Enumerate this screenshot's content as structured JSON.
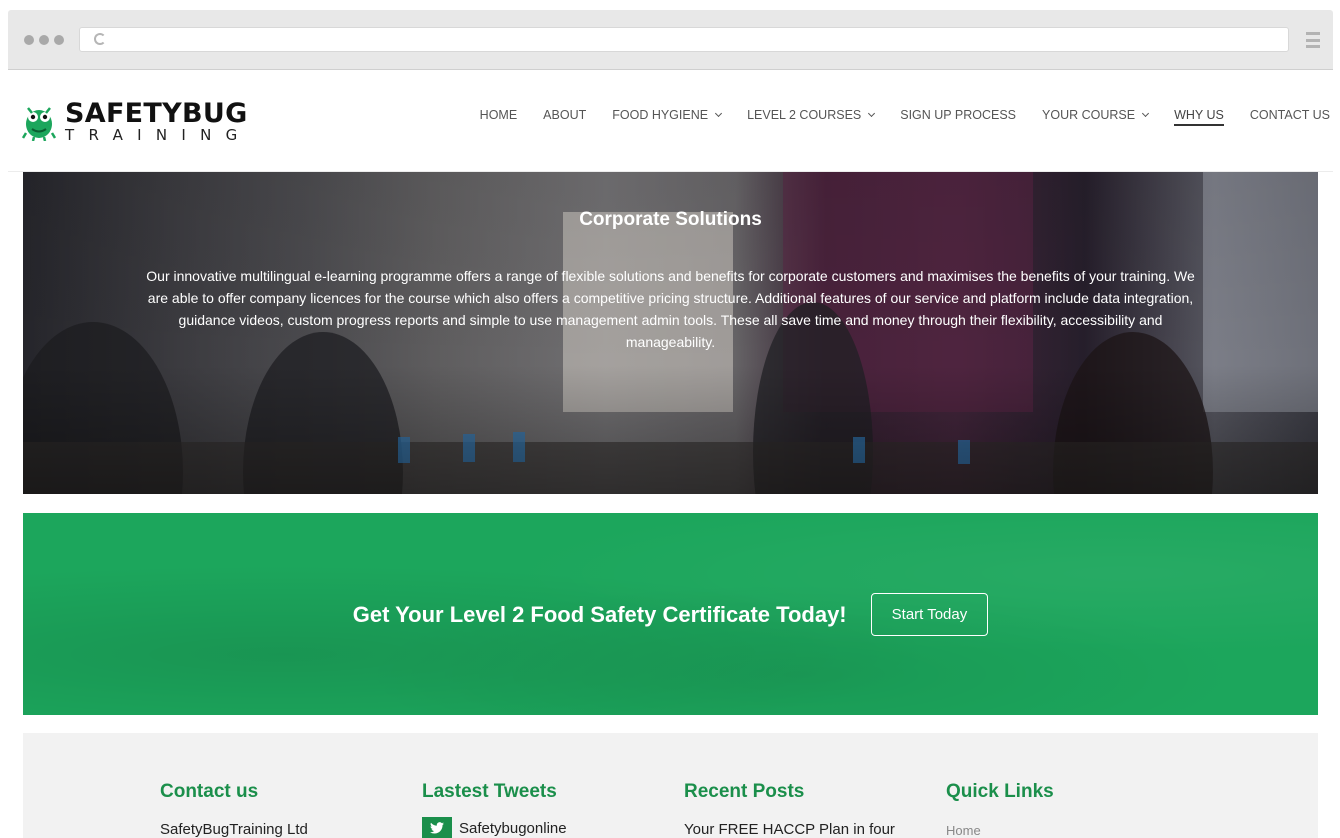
{
  "browser": {
    "url": ""
  },
  "site": {
    "logo_name": "SAFETYBUG",
    "logo_sub": "TRAINING"
  },
  "nav": {
    "items": [
      {
        "label": "HOME",
        "dropdown": false
      },
      {
        "label": "ABOUT",
        "dropdown": false
      },
      {
        "label": "FOOD HYGIENE",
        "dropdown": true
      },
      {
        "label": "LEVEL 2 COURSES",
        "dropdown": true
      },
      {
        "label": "SIGN UP PROCESS",
        "dropdown": false
      },
      {
        "label": "YOUR COURSE",
        "dropdown": true
      },
      {
        "label": "WHY US",
        "dropdown": false,
        "active": true
      },
      {
        "label": "CONTACT US",
        "dropdown": false
      }
    ]
  },
  "hero": {
    "title": "Corporate Solutions",
    "body": "Our innovative multilingual e-learning programme offers a range of flexible solutions and benefits for corporate customers and maximises the benefits of your training. We are able to offer company licences for the course which also offers a competitive pricing structure. Additional features of our service and platform include data integration, guidance videos, custom progress reports and simple to use management admin tools. These all save time and money through their flexibility, accessibility and manageability."
  },
  "cta": {
    "text": "Get Your Level 2 Food Safety Certificate Today!",
    "button": "Start Today"
  },
  "footer": {
    "contact": {
      "heading": "Contact us",
      "line": "SafetyBugTraining Ltd"
    },
    "tweets": {
      "heading": "Lastest Tweets",
      "handle": "Safetybugonline"
    },
    "posts": {
      "heading": "Recent Posts",
      "first": "Your FREE HACCP Plan in four"
    },
    "links": {
      "heading": "Quick Links",
      "first": "Home"
    }
  },
  "colors": {
    "brand_green": "#1ca65c",
    "heading_green": "#1b8f4b"
  }
}
